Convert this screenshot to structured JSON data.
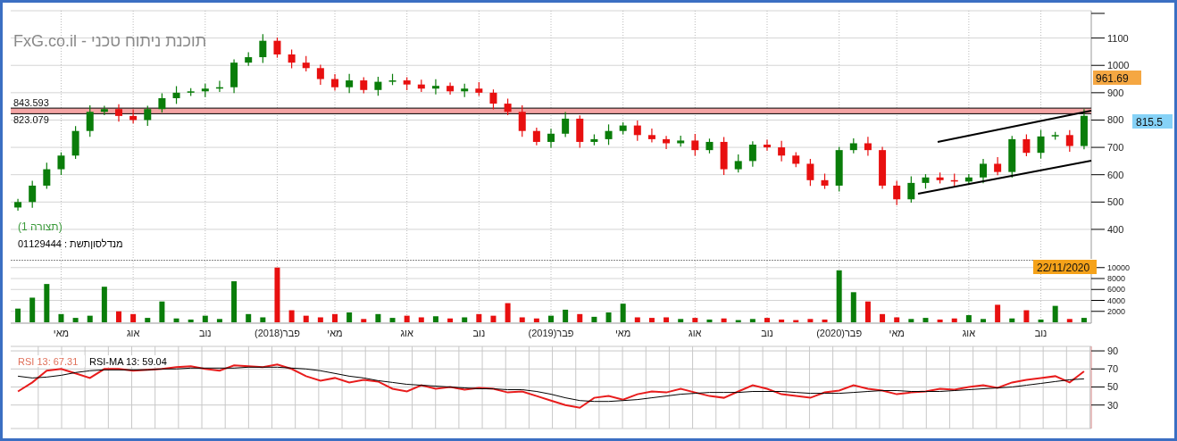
{
  "title": "FxG.co.il - תוכנת ניתוח טכני",
  "price_panel": {
    "config_label": "(תצורה 1)",
    "symbol_label": "מנדלסוןתשת : 01129444",
    "badges": [
      {
        "text": "961.69",
        "color": "#f5a742"
      },
      {
        "text": "815.5",
        "color": "#86d2f7"
      }
    ],
    "chart_data": {
      "type": "candlestick",
      "grid": true,
      "ylim": [
        292,
        1200
      ],
      "yticks": [
        400,
        500,
        600,
        700,
        800,
        900,
        1000,
        1100
      ],
      "categories": [
        null,
        null,
        null,
        null,
        null,
        null,
        null,
        null,
        null,
        null,
        null,
        null,
        null,
        null,
        null,
        null,
        null,
        null,
        null,
        null,
        null,
        null,
        null,
        null,
        null,
        null,
        null,
        null,
        null,
        null,
        null,
        null,
        null,
        null,
        null,
        null,
        null,
        null,
        null,
        null,
        null,
        null,
        null,
        null,
        null,
        null,
        null,
        null,
        null,
        null,
        null,
        null,
        null,
        null,
        null,
        null,
        null,
        null,
        null,
        null,
        null,
        null,
        null,
        null,
        null,
        null,
        null,
        null,
        null,
        null,
        null,
        null,
        null,
        null,
        null
      ],
      "ohlc": [
        [
          480,
          512,
          468,
          500
        ],
        [
          500,
          578,
          479,
          560
        ],
        [
          560,
          644,
          548,
          620
        ],
        [
          620,
          682,
          599,
          670
        ],
        [
          670,
          778,
          658,
          760
        ],
        [
          760,
          854,
          739,
          830
        ],
        [
          830,
          852,
          818,
          840
        ],
        [
          840,
          858,
          794,
          815
        ],
        [
          815,
          839,
          788,
          800
        ],
        [
          800,
          852,
          779,
          840
        ],
        [
          840,
          898,
          828,
          880
        ],
        [
          880,
          924,
          859,
          900
        ],
        [
          900,
          917,
          888,
          905
        ],
        [
          905,
          933,
          884,
          915
        ],
        [
          915,
          944,
          903,
          920
        ],
        [
          920,
          1022,
          899,
          1010
        ],
        [
          1010,
          1048,
          998,
          1030
        ],
        [
          1030,
          1114,
          1009,
          1090
        ],
        [
          1090,
          1102,
          1028,
          1040
        ],
        [
          1040,
          1058,
          989,
          1010
        ],
        [
          1010,
          1034,
          978,
          990
        ],
        [
          990,
          1002,
          929,
          950
        ],
        [
          950,
          968,
          908,
          920
        ],
        [
          920,
          969,
          899,
          945
        ],
        [
          945,
          957,
          898,
          910
        ],
        [
          910,
          958,
          889,
          940
        ],
        [
          940,
          969,
          928,
          945
        ],
        [
          945,
          957,
          909,
          930
        ],
        [
          930,
          948,
          903,
          915
        ],
        [
          915,
          949,
          894,
          925
        ],
        [
          925,
          937,
          893,
          905
        ],
        [
          905,
          933,
          884,
          915
        ],
        [
          915,
          939,
          888,
          900
        ],
        [
          900,
          912,
          839,
          860
        ],
        [
          860,
          878,
          818,
          830
        ],
        [
          830,
          854,
          739,
          760
        ],
        [
          760,
          772,
          708,
          720
        ],
        [
          720,
          768,
          699,
          750
        ],
        [
          750,
          829,
          738,
          805
        ],
        [
          805,
          817,
          699,
          720
        ],
        [
          720,
          748,
          708,
          730
        ],
        [
          730,
          784,
          709,
          760
        ],
        [
          760,
          792,
          748,
          780
        ],
        [
          780,
          798,
          724,
          745
        ],
        [
          745,
          769,
          718,
          730
        ],
        [
          730,
          742,
          694,
          715
        ],
        [
          715,
          743,
          703,
          725
        ],
        [
          725,
          749,
          669,
          690
        ],
        [
          690,
          732,
          678,
          720
        ],
        [
          720,
          738,
          599,
          620
        ],
        [
          620,
          674,
          608,
          650
        ],
        [
          650,
          722,
          629,
          710
        ],
        [
          710,
          728,
          688,
          700
        ],
        [
          700,
          724,
          649,
          670
        ],
        [
          670,
          682,
          628,
          640
        ],
        [
          640,
          658,
          559,
          580
        ],
        [
          580,
          604,
          548,
          560
        ],
        [
          560,
          702,
          539,
          690
        ],
        [
          690,
          733,
          678,
          715
        ],
        [
          715,
          739,
          669,
          690
        ],
        [
          690,
          702,
          548,
          560
        ],
        [
          560,
          578,
          489,
          510
        ],
        [
          510,
          594,
          498,
          570
        ],
        [
          570,
          602,
          549,
          590
        ],
        [
          590,
          608,
          568,
          580
        ],
        [
          580,
          604,
          554,
          575
        ],
        [
          575,
          602,
          563,
          590
        ],
        [
          590,
          658,
          569,
          640
        ],
        [
          640,
          664,
          598,
          610
        ],
        [
          610,
          742,
          589,
          730
        ],
        [
          730,
          748,
          668,
          680
        ],
        [
          680,
          764,
          659,
          740
        ],
        [
          740,
          757,
          728,
          745
        ],
        [
          745,
          763,
          684,
          705
        ],
        [
          705,
          839.5,
          693,
          815.5
        ]
      ],
      "bands": [
        {
          "axis": "y",
          "from": 823.079,
          "to": 843.593,
          "color": "#f4a4a4"
        }
      ],
      "ref_lines": [
        {
          "axis": "y",
          "value": 843.593,
          "label": "843.593"
        },
        {
          "axis": "y",
          "value": 823.079,
          "label": "823.079"
        }
      ]
    }
  },
  "volume_panel": {
    "date_badge": "22/11/2020",
    "chart_data": {
      "type": "bar",
      "grid": true,
      "ylim": [
        0,
        11430
      ],
      "yticks": [
        2000,
        4000,
        6000,
        8000,
        10000
      ],
      "categories": [
        null,
        null,
        null,
        "מאי",
        null,
        null,
        null,
        null,
        "אוג",
        null,
        null,
        null,
        null,
        "נוב",
        null,
        null,
        null,
        null,
        "פבר(2018)",
        null,
        null,
        null,
        "מאי",
        null,
        null,
        null,
        null,
        "אוג",
        null,
        null,
        null,
        null,
        "נוב",
        null,
        null,
        null,
        null,
        "פבר(2019)",
        null,
        null,
        null,
        null,
        "מאי",
        null,
        null,
        null,
        null,
        "אוג",
        null,
        null,
        null,
        null,
        "נוב",
        null,
        null,
        null,
        null,
        "פבר(2020)",
        null,
        null,
        null,
        "מאי",
        null,
        null,
        null,
        null,
        "אוג",
        null,
        null,
        null,
        null,
        "נוב",
        null,
        null,
        null
      ],
      "values": [
        2500,
        4500,
        7000,
        1500,
        800,
        1200,
        6500,
        2000,
        1500,
        800,
        3800,
        700,
        500,
        1200,
        600,
        7500,
        1500,
        900,
        10000,
        2200,
        1200,
        900,
        1500,
        1800,
        600,
        1500,
        800,
        1200,
        900,
        1100,
        700,
        900,
        1500,
        1200,
        3500,
        900,
        700,
        1200,
        2300,
        1500,
        1000,
        1800,
        3400,
        900,
        800,
        900,
        600,
        800,
        500,
        700,
        400,
        600,
        800,
        500,
        400,
        600,
        500,
        9500,
        5500,
        3800,
        1500,
        900,
        600,
        800,
        500,
        700,
        1300,
        600,
        3200,
        700,
        2200,
        500,
        3000,
        600,
        800
      ]
    }
  },
  "rsi_panel": {
    "legend": [
      {
        "text": "RSI-MA 13: 59.04",
        "color": "#000000"
      },
      {
        "text": "RSI 13: 67.31",
        "color": "#e0705a"
      }
    ],
    "chart_data": {
      "type": "line",
      "grid": true,
      "ylim": [
        4,
        95
      ],
      "yticks": [
        30,
        50,
        70,
        90
      ],
      "series": [
        {
          "color": "#e81c1c",
          "values": [
            45,
            55,
            68,
            70,
            65,
            60,
            70,
            70,
            68,
            69,
            70,
            72,
            73,
            70,
            68,
            74,
            73,
            72,
            75,
            70,
            62,
            57,
            60,
            55,
            58,
            56,
            48,
            45,
            52,
            48,
            50,
            47,
            49,
            48,
            44,
            45,
            40,
            35,
            30,
            27,
            38,
            40,
            36,
            42,
            45,
            44,
            48,
            44,
            40,
            38,
            45,
            52,
            48,
            42,
            40,
            38,
            44,
            46,
            52,
            48,
            46,
            42,
            44,
            45,
            48,
            47,
            50,
            52,
            49,
            55,
            58,
            60,
            62,
            55,
            67.3
          ]
        },
        {
          "color": "#000000",
          "values": [
            62,
            60,
            61,
            63,
            66,
            68,
            69,
            69,
            69,
            69,
            70,
            70,
            71,
            71,
            71,
            71,
            72,
            72,
            72,
            71,
            70,
            68,
            65,
            62,
            60,
            57,
            55,
            53,
            52,
            51,
            50,
            49,
            48,
            48,
            47,
            47,
            45,
            42,
            38,
            35,
            34,
            34,
            35,
            36,
            38,
            40,
            42,
            43,
            44,
            44,
            44,
            45,
            45,
            45,
            44,
            43,
            43,
            43,
            44,
            45,
            46,
            46,
            45,
            45,
            45,
            46,
            47,
            48,
            49,
            50,
            52,
            54,
            56,
            58,
            59
          ]
        }
      ]
    }
  }
}
